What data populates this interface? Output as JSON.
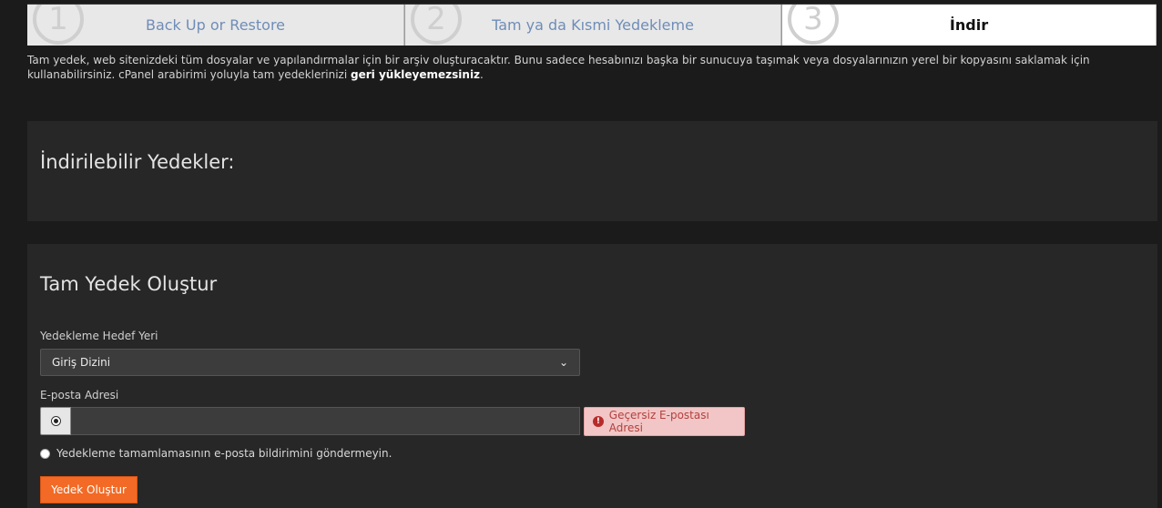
{
  "steps": [
    {
      "number": "1",
      "label": "Back Up or Restore"
    },
    {
      "number": "2",
      "label": "Tam ya da Kısmi Yedekleme"
    },
    {
      "number": "3",
      "label": "İndir"
    }
  ],
  "intro": {
    "text": "Tam yedek, web sitenizdeki tüm dosyalar ve yapılandırmalar için bir arşiv oluşturacaktır. Bunu sadece hesabınızı başka bir sunucuya taşımak veya dosyalarınızın yerel bir kopyasını saklamak için kullanabilirsiniz. cPanel arabirimi yoluyla tam yedeklerinizi ",
    "bold": "geri yükleyemezsiniz",
    "end": "."
  },
  "downloadable": {
    "title": "İndirilebilir Yedekler:"
  },
  "create": {
    "title": "Tam Yedek Oluştur",
    "destination_label": "Yedekleme Hedef Yeri",
    "destination_value": "Giriş Dizini",
    "email_label": "E-posta Adresi",
    "email_value": "",
    "email_error": "Geçersiz E-postası Adresi",
    "no_email_option": "Yedekleme tamamlamasının e-posta bildirimini göndermeyin.",
    "submit_label": "Yedek Oluştur"
  },
  "colors": {
    "accent": "#f26a25",
    "error_bg": "#f2c6c6",
    "error_text": "#b2413f"
  }
}
